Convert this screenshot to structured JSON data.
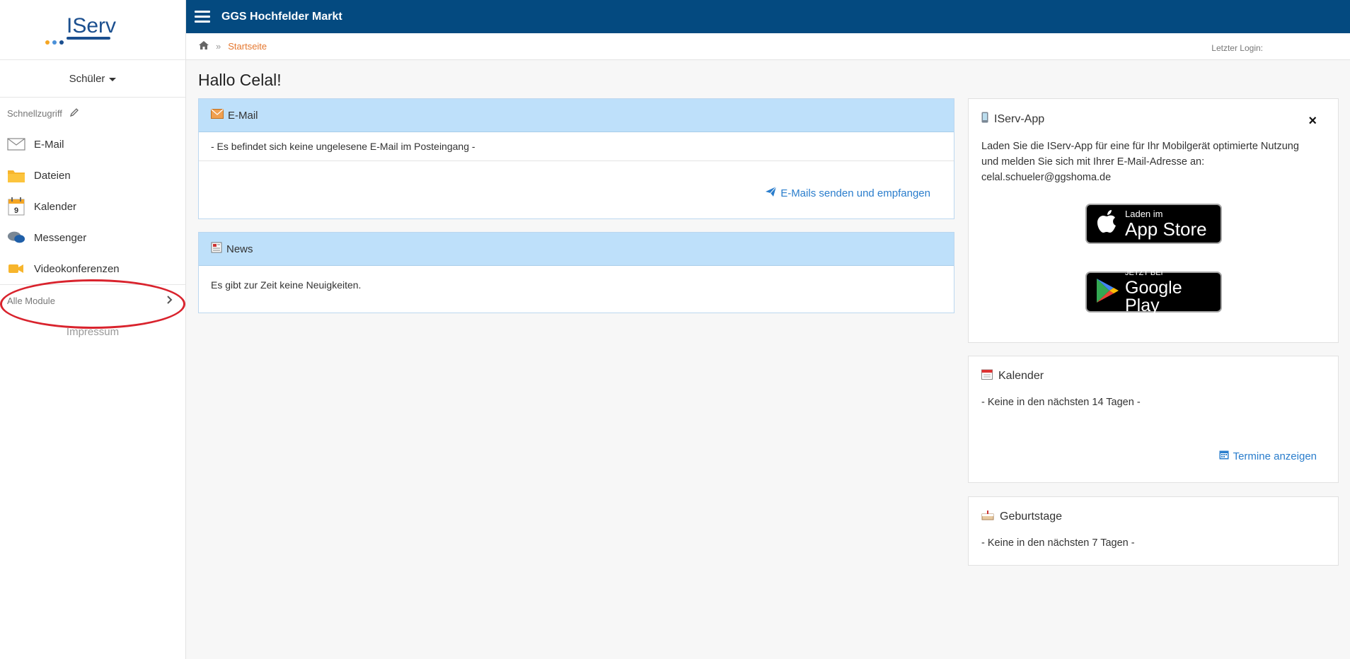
{
  "logo": {
    "text": "IServ"
  },
  "sidebar": {
    "role": "Schüler",
    "quick_access": "Schnellzugriff",
    "items": [
      {
        "label": "E-Mail",
        "icon": "envelope-icon"
      },
      {
        "label": "Dateien",
        "icon": "folder-icon"
      },
      {
        "label": "Kalender",
        "icon": "calendar-icon"
      },
      {
        "label": "Messenger",
        "icon": "chat-bubbles-icon"
      },
      {
        "label": "Videokonferenzen",
        "icon": "video-camera-icon"
      }
    ],
    "all_modules": "Alle Module",
    "impressum": "Impressum",
    "calendar_day": "9"
  },
  "topbar": {
    "title": "GGS Hochfelder Markt"
  },
  "breadcrumb": {
    "sep": "»",
    "current": "Startseite",
    "last_login": "Letzter Login:"
  },
  "greeting": "Hallo Celal!",
  "email_panel": {
    "title": "E-Mail",
    "message": "- Es befindet sich keine ungelesene E-Mail im Posteingang -",
    "link": "E-Mails senden und empfangen"
  },
  "news_panel": {
    "title": "News",
    "message": "Es gibt zur Zeit keine Neuigkeiten."
  },
  "app_panel": {
    "title": "IServ-App",
    "close": "×",
    "text_line1": "Laden Sie die IServ-App für eine für Ihr Mobilgerät optimierte Nutzung",
    "text_line2": "und melden Sie sich mit Ihrer E-Mail-Adresse an:",
    "email": "celal.schueler@ggshoma.de",
    "appstore_small": "Laden im",
    "appstore_big": "App Store",
    "play_small": "JETZT BEI",
    "play_big": "Google Play"
  },
  "calendar_panel": {
    "title": "Kalender",
    "message": "- Keine in den nächsten 14 Tagen -",
    "link": "Termine anzeigen"
  },
  "birthday_panel": {
    "title": "Geburtstage",
    "message": "- Keine in den nächsten 7 Tagen -"
  },
  "colors": {
    "topbar": "#044a80",
    "accent": "#e5772e",
    "link": "#2a7dcc",
    "panel_head": "#bee0fa",
    "highlight": "#d9232d"
  }
}
